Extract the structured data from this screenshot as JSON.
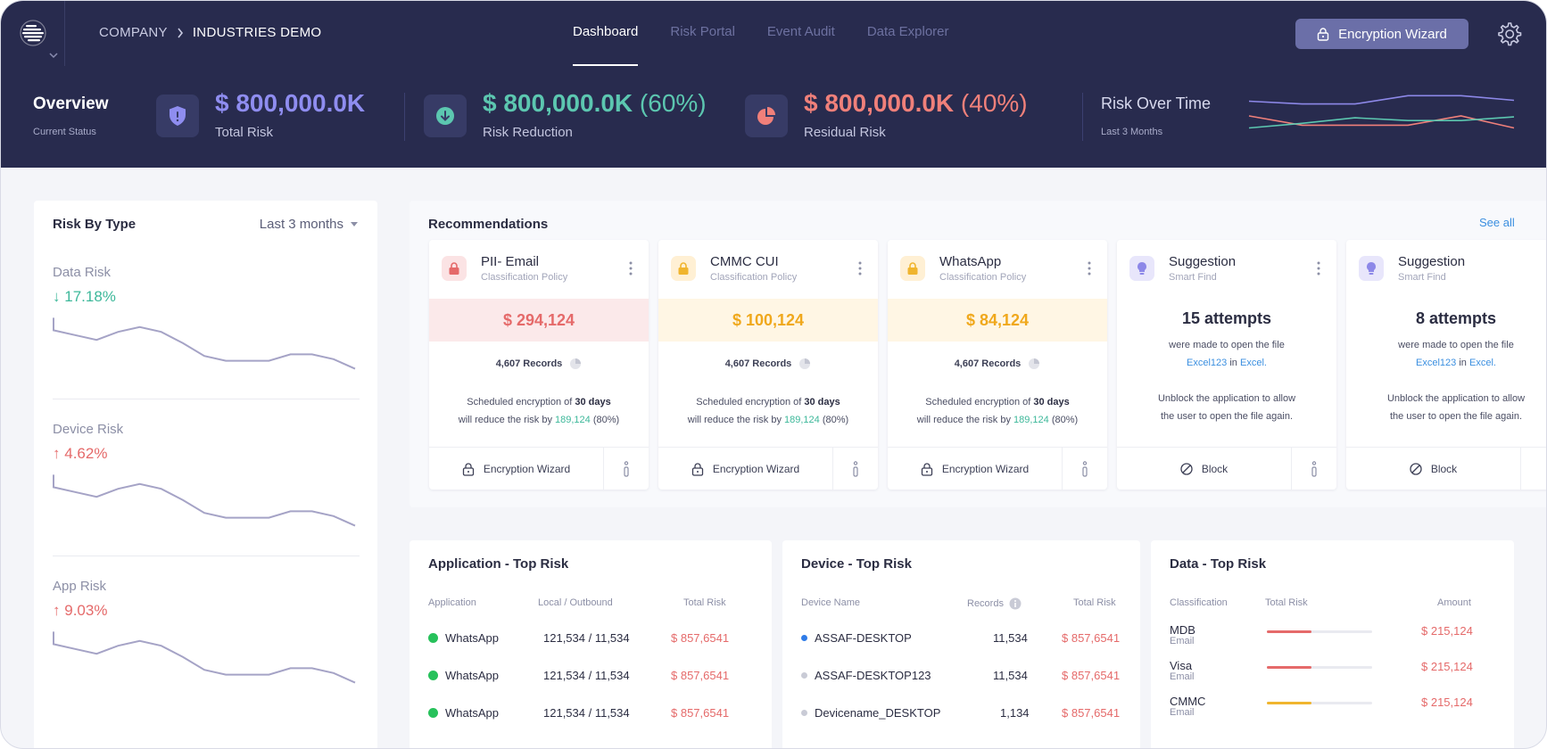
{
  "header": {
    "breadcrumb": {
      "company": "COMPANY",
      "current": "INDUSTRIES DEMO"
    },
    "tabs": [
      {
        "label": "Dashboard",
        "active": true
      },
      {
        "label": "Risk Portal",
        "active": false
      },
      {
        "label": "Event Audit",
        "active": false
      },
      {
        "label": "Data Explorer",
        "active": false
      }
    ],
    "encryption_button": "Encryption Wizard",
    "icons": {
      "logo": "app-logo-icon",
      "settings": "gear-icon"
    }
  },
  "overview": {
    "title": "Overview",
    "subtitle": "Current Status",
    "metrics": [
      {
        "value": "$ 800,000.0K",
        "percent": "",
        "label": "Total Risk",
        "color": "#8f8df0",
        "icon": "shield-icon"
      },
      {
        "value": "$ 800,000.0K",
        "percent": "(60%)",
        "label": "Risk Reduction",
        "color": "#5cc7b0",
        "icon": "download-icon"
      },
      {
        "value": "$ 800,000.0K",
        "percent": "(40%)",
        "label": "Residual Risk",
        "color": "#f0807a",
        "icon": "pie-icon"
      }
    ],
    "risk_over_time": {
      "title": "Risk Over Time",
      "subtitle": "Last 3 Months",
      "chart_data": {
        "type": "line",
        "x": [
          0,
          1,
          2,
          3,
          4,
          5
        ],
        "series": [
          {
            "values": [
              9.0,
              8.4,
              8.4,
              10.2,
              10.2,
              9.2
            ],
            "color": "#8d88e8"
          },
          {
            "values": [
              5.8,
              3.8,
              3.8,
              3.8,
              5.8,
              3.2
            ],
            "color": "#f0807a"
          },
          {
            "values": [
              3.2,
              4.2,
              5.4,
              4.8,
              4.8,
              5.6
            ],
            "color": "#5cc7b0"
          }
        ],
        "ylim": [
          0,
          12
        ]
      }
    }
  },
  "risk_by_type": {
    "title": "Risk By Type",
    "range": "Last 3 months",
    "items": [
      {
        "name": "Data Risk",
        "change": "17.18%",
        "direction": "down",
        "color": "#3db89a",
        "chart_data": {
          "type": "line",
          "values": [
            7.4,
            6.8,
            6.2,
            7.2,
            7.8,
            7.2,
            5.8,
            4.2,
            3.6,
            3.6,
            3.6,
            4.4,
            4.4,
            3.8,
            2.6
          ],
          "ylim": [
            0,
            10
          ]
        }
      },
      {
        "name": "Device Risk",
        "change": "4.62%",
        "direction": "up",
        "color": "#e56a6a",
        "chart_data": {
          "type": "line",
          "values": [
            7.4,
            6.8,
            6.2,
            7.2,
            7.8,
            7.2,
            5.8,
            4.2,
            3.6,
            3.6,
            3.6,
            4.4,
            4.4,
            3.8,
            2.6
          ],
          "ylim": [
            0,
            10
          ]
        }
      },
      {
        "name": "App Risk",
        "change": "9.03%",
        "direction": "up",
        "color": "#e56a6a",
        "chart_data": {
          "type": "line",
          "values": [
            7.4,
            6.8,
            6.2,
            7.2,
            7.8,
            7.2,
            5.8,
            4.2,
            3.6,
            3.6,
            3.6,
            4.4,
            4.4,
            3.8,
            2.6
          ],
          "ylim": [
            0,
            10
          ]
        }
      }
    ]
  },
  "recommendations": {
    "title": "Recommendations",
    "see_all": "See all",
    "policy_cards": [
      {
        "title": "PII- Email",
        "subtitle": "Classification Policy",
        "amount": "$ 294,124",
        "amount_color": "#e56a6a",
        "band_color": "#fbe9ea",
        "icon_bg": "#fbe3e4",
        "icon_color": "#e56a6a",
        "records": "4,607 Records",
        "text_a": "Scheduled encryption of",
        "text_days": "30 days",
        "text_b": "will reduce the risk by",
        "text_amount": "189,124",
        "text_pct": "(80%)",
        "action": "Encryption Wizard"
      },
      {
        "title": "CMMC CUI",
        "subtitle": "Classification Policy",
        "amount": "$ 100,124",
        "amount_color": "#f0a81c",
        "band_color": "#fff6e4",
        "icon_bg": "#fff0d4",
        "icon_color": "#f0b52e",
        "records": "4,607 Records",
        "text_a": "Scheduled encryption of",
        "text_days": "30 days",
        "text_b": "will reduce the risk by",
        "text_amount": "189,124",
        "text_pct": "(80%)",
        "action": "Encryption Wizard"
      },
      {
        "title": "WhatsApp",
        "subtitle": "Classification Policy",
        "amount": "$ 84,124",
        "amount_color": "#f0a81c",
        "band_color": "#fff6e4",
        "icon_bg": "#fff0d4",
        "icon_color": "#f0b52e",
        "records": "4,607 Records",
        "text_a": "Scheduled encryption of",
        "text_days": "30 days",
        "text_b": "will reduce the risk by",
        "text_amount": "189,124",
        "text_pct": "(80%)",
        "action": "Encryption Wizard"
      }
    ],
    "suggestion_cards": [
      {
        "title": "Suggestion",
        "subtitle": "Smart Find",
        "attempts": "15 attempts",
        "line1": "were made to open the file",
        "file": "Excel123",
        "in": "in",
        "app": "Excel.",
        "line3": "Unblock the application to allow",
        "line4": "the user to open the file again.",
        "action": "Block"
      },
      {
        "title": "Suggestion",
        "subtitle": "Smart Find",
        "attempts": "8 attempts",
        "line1": "were made to open the file",
        "file": "Excel123",
        "in": "in",
        "app": "Excel.",
        "line3": "Unblock the application to allow",
        "line4": "the user to open the file again.",
        "action": "Block"
      }
    ]
  },
  "app_top_risk": {
    "title": "Application - Top Risk",
    "columns": [
      "Application",
      "Local / Outbound",
      "Total Risk"
    ],
    "rows": [
      {
        "app": "WhatsApp",
        "traffic": "121,534 / 11,534",
        "risk": "$ 857,6541"
      },
      {
        "app": "WhatsApp",
        "traffic": "121,534 / 11,534",
        "risk": "$ 857,6541"
      },
      {
        "app": "WhatsApp",
        "traffic": "121,534 / 11,534",
        "risk": "$ 857,6541"
      }
    ]
  },
  "device_top_risk": {
    "title": "Device - Top Risk",
    "columns": [
      "Device Name",
      "Records",
      "Total Risk"
    ],
    "rows": [
      {
        "device": "ASSAF-DESKTOP",
        "records": "11,534",
        "risk": "$ 857,6541",
        "dot": "#2f7ce8"
      },
      {
        "device": "ASSAF-DESKTOP123",
        "records": "11,534",
        "risk": "$ 857,6541",
        "dot": "#c9cbd6"
      },
      {
        "device": "Devicename_DESKTOP",
        "records": "1,134",
        "risk": "$ 857,6541",
        "dot": "#c9cbd6"
      }
    ]
  },
  "data_top_risk": {
    "title": "Data - Top Risk",
    "columns": [
      "Classification",
      "Total Risk",
      "Amount"
    ],
    "rows": [
      {
        "name": "MDB",
        "type": "Email",
        "risk": 0.42,
        "color": "#e56a6a",
        "amount": "$ 215,124"
      },
      {
        "name": "Visa",
        "type": "Email",
        "risk": 0.42,
        "color": "#e56a6a",
        "amount": "$ 215,124"
      },
      {
        "name": "CMMC",
        "type": "Email",
        "risk": 0.42,
        "color": "#f0b52e",
        "amount": "$ 215,124"
      }
    ]
  }
}
